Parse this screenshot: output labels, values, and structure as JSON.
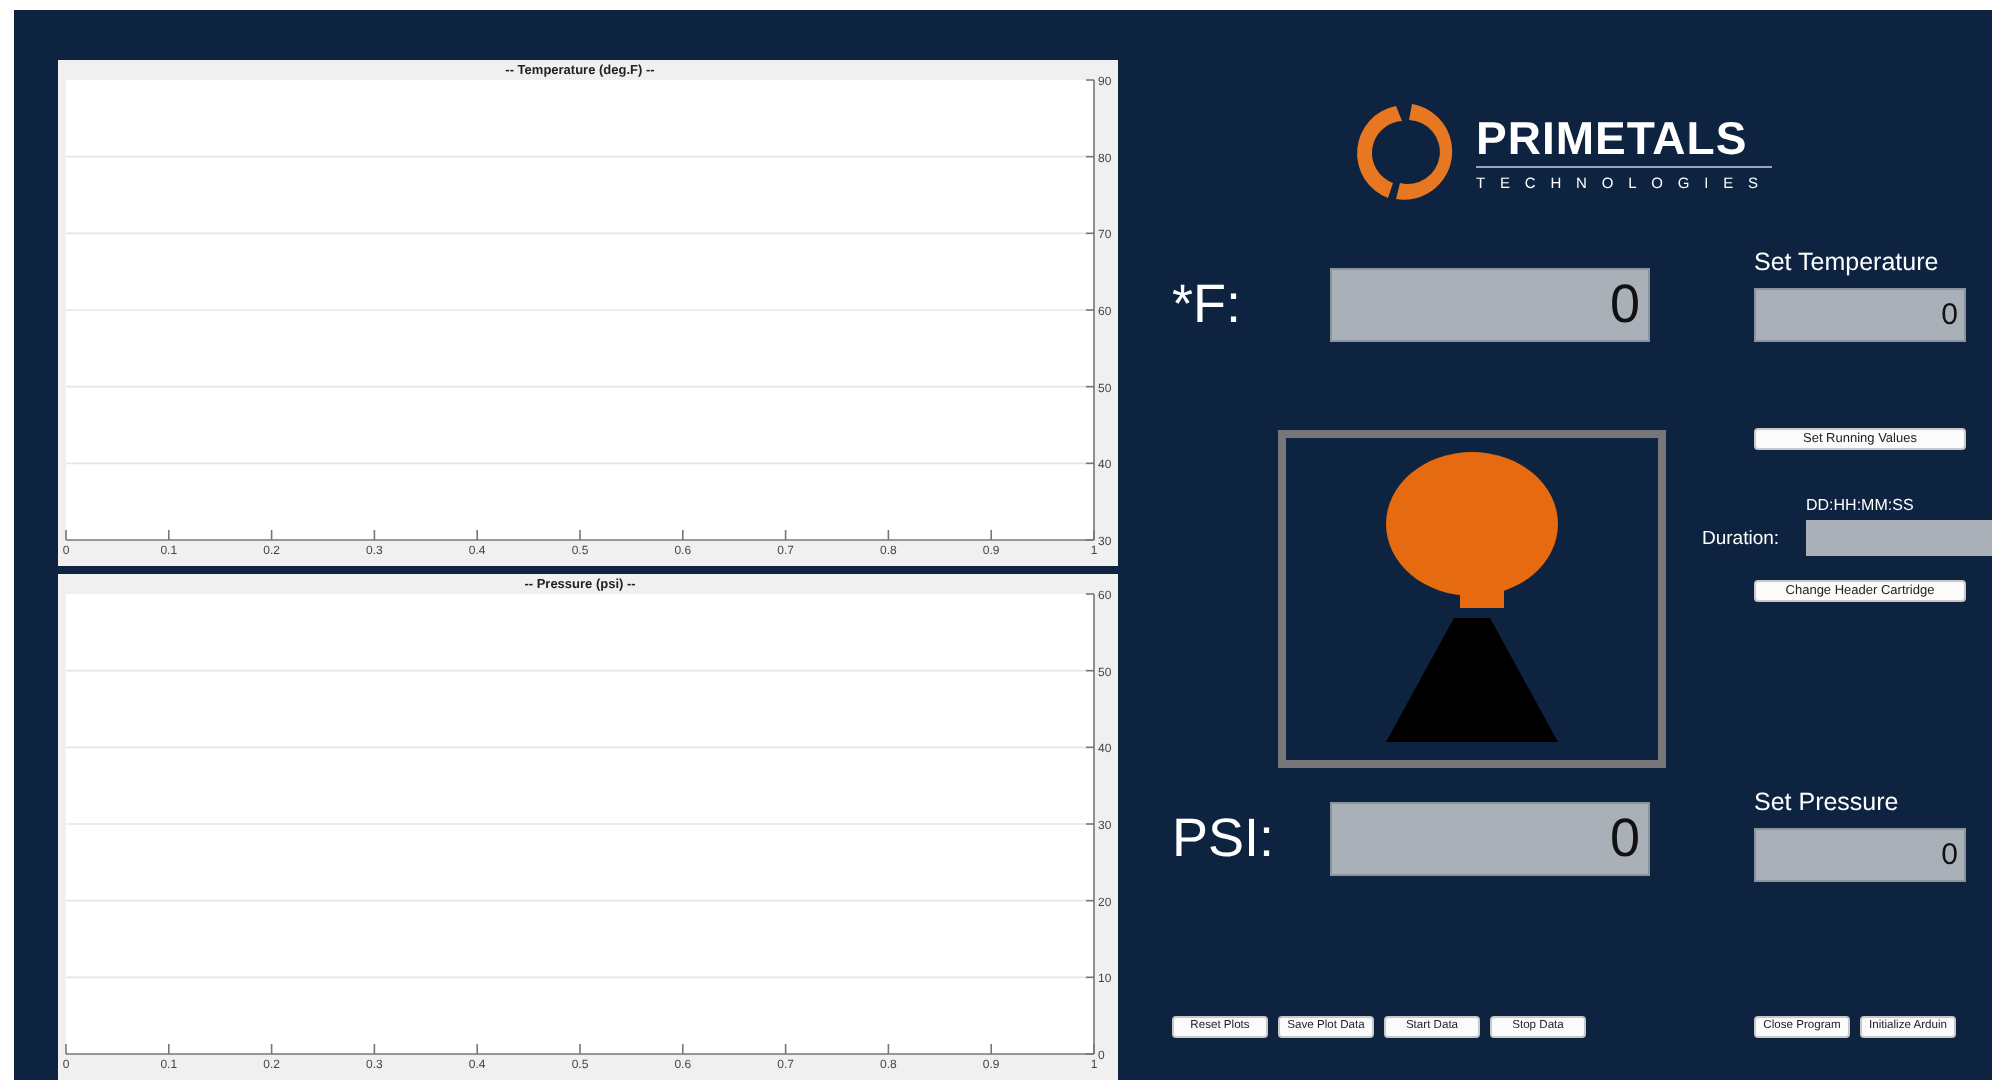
{
  "charts": [
    {
      "chart_data": {
        "type": "line",
        "grid": true,
        "title": "-- Temperature (deg.F) --",
        "xlim": [
          0,
          1
        ],
        "ylim": [
          30,
          90
        ],
        "xticks": [
          0,
          0.1,
          0.2,
          0.3,
          0.4,
          0.5,
          0.6,
          0.7,
          0.8,
          0.9,
          1
        ],
        "yticks": [
          30,
          40,
          50,
          60,
          70,
          80,
          90
        ]
      }
    },
    {
      "chart_data": {
        "type": "line",
        "grid": true,
        "title": "-- Pressure (psi) --",
        "xlim": [
          0,
          1
        ],
        "ylim": [
          0,
          60
        ],
        "xticks": [
          0,
          0.1,
          0.2,
          0.3,
          0.4,
          0.5,
          0.6,
          0.7,
          0.8,
          0.9,
          1
        ],
        "yticks": [
          0,
          10,
          20,
          30,
          40,
          50,
          60
        ]
      }
    }
  ],
  "logo": {
    "name": "PRIMETALS",
    "tagline": "TECHNOLOGIES"
  },
  "readouts": [
    {
      "label": "*F:",
      "value": "0"
    },
    {
      "label": "PSI:",
      "value": "0"
    }
  ],
  "setpoints": [
    {
      "label": "Set Temperature",
      "value": "0"
    },
    {
      "label": "Set Pressure",
      "value": "0"
    }
  ],
  "set_running_button": "Set Running Values",
  "duration": {
    "hint": "DD:HH:MM:SS",
    "label": "Duration:"
  },
  "change_cartridge_button": "Change Header Cartridge",
  "plot_buttons": [
    "Reset Plots",
    "Save Plot Data",
    "Start Data",
    "Stop Data"
  ],
  "program_buttons": [
    "Close Program",
    "Initialize Arduin"
  ]
}
